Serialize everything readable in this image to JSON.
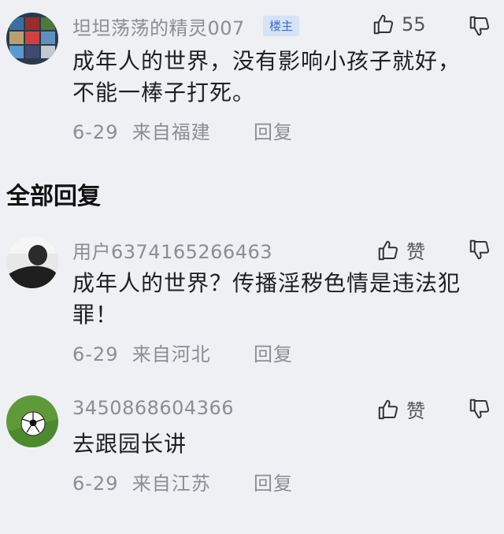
{
  "op_comment": {
    "username": "坦坦荡荡的精灵007",
    "badge": "楼主",
    "like_count": "55",
    "text": "成年人的世界，没有影响小孩子就好，不能一棒子打死。",
    "date": "6-29",
    "location": "来自福建",
    "reply_label": "回复"
  },
  "section_title": "全部回复",
  "replies": [
    {
      "username": "用户6374165266463",
      "like_label": "赞",
      "text": "成年人的世界？传播淫秽色情是违法犯罪！",
      "date": "6-29",
      "location": "来自河北",
      "reply_label": "回复"
    },
    {
      "username": "3450868604366",
      "like_label": "赞",
      "text": "去跟园长讲",
      "date": "6-29",
      "location": "来自江苏",
      "reply_label": "回复"
    }
  ],
  "icons": {
    "like": "thumbs-up-icon",
    "dislike": "thumbs-down-icon"
  }
}
